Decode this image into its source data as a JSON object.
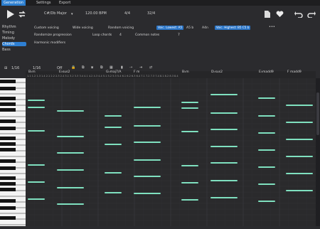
{
  "tabs": [
    {
      "label": "Generation",
      "active": true
    },
    {
      "label": "Settings",
      "active": false
    },
    {
      "label": "Export",
      "active": false
    }
  ],
  "transport": {
    "key": "C#/Db Major",
    "tempo": "120.00 BPM",
    "time_signature": "4/4",
    "bars": "32/4"
  },
  "sidebar": {
    "items": [
      {
        "label": "Rhythm",
        "active": false
      },
      {
        "label": "Timing",
        "active": false
      },
      {
        "label": "Melody",
        "active": false
      },
      {
        "label": "Chords",
        "active": true
      },
      {
        "label": "Bass",
        "active": false
      }
    ]
  },
  "settings": {
    "row1": [
      {
        "label": "Custom voicing"
      },
      {
        "label": "Wide voicing"
      },
      {
        "label": "Random voicing"
      },
      {
        "badge": "Voic. Lowest: A5"
      },
      {
        "label": "A5 b"
      },
      {
        "label": "A4n"
      },
      {
        "badge": "Voic. Highest: B5 C5 b"
      }
    ],
    "row2": [
      {
        "label": "Randomize progression"
      },
      {
        "label": "Loop chords"
      },
      {
        "label": "4"
      },
      {
        "label": "Common notes"
      },
      {
        "label": "7"
      }
    ],
    "row3": "Harmonic modifiers"
  },
  "pianoroll": {
    "toolbar": {
      "snap_1": "1/16",
      "snap_2": "1/16",
      "mode": "Off"
    },
    "chords": [
      {
        "label": "B♭m",
        "bar": 1
      },
      {
        "label": "E♭sus2",
        "bar": 2
      },
      {
        "label": "G♭maj7/A",
        "bar": 3
      },
      {
        "label": "F m",
        "bar": 4
      },
      {
        "label": "B♭m",
        "bar": 5
      },
      {
        "label": "D♭sus2",
        "bar": 6
      },
      {
        "label": "E♭madd9",
        "bar": 7
      },
      {
        "label": "F madd9",
        "bar": 8
      }
    ],
    "ruler_digits": "1.1 1.2 1.3 1.4 2.1 2.2 2.3 2.4 3.1 3.2 3.3 3.4 4.1 4.2 4.3 4.4 5.1 5.2 5.3 5.4 6.1 6.2 6.3 6.4 7.1 7.2 7.3 7.4 8.1 8.2 8.3 8.4"
  },
  "colors": {
    "accent": "#2e7fd2",
    "note": "#7fe0bf",
    "background": "#2b2b2e"
  }
}
